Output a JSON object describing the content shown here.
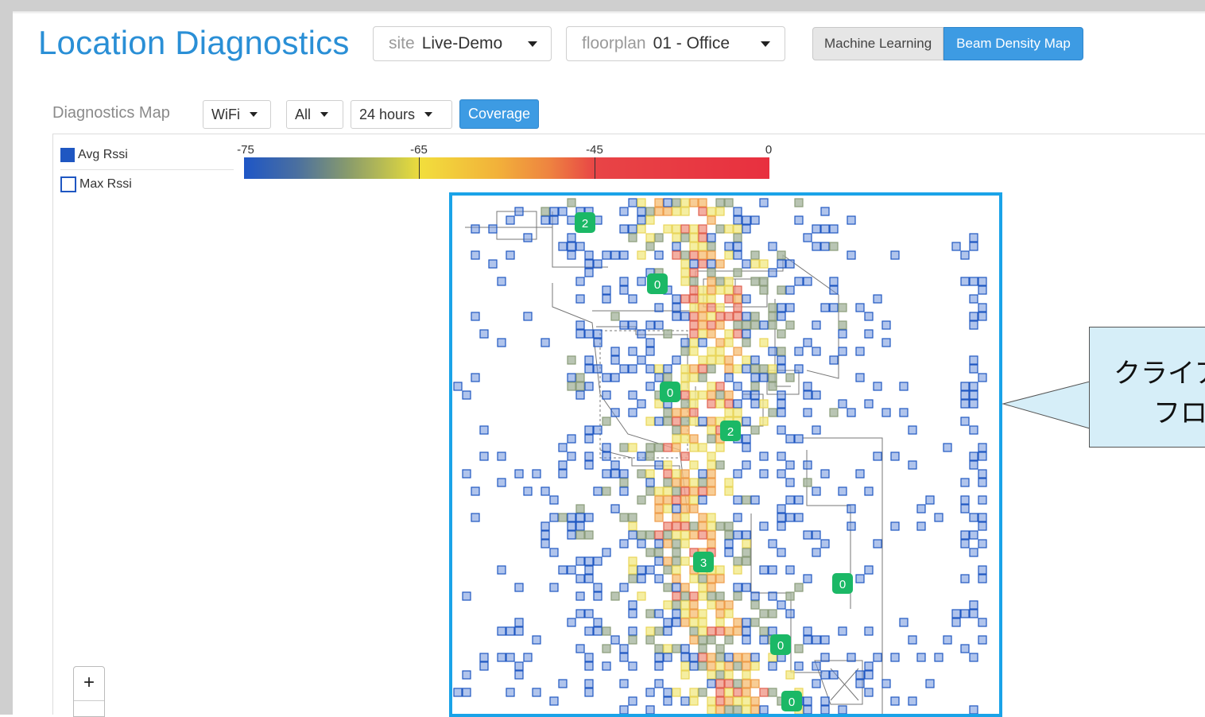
{
  "header": {
    "title": "Location Diagnostics",
    "site_label": "site",
    "site_value": "Live-Demo",
    "floorplan_label": "floorplan",
    "floorplan_value": "01 - Office",
    "tabs": [
      "Machine Learning",
      "Beam Density Map"
    ],
    "active_tab": "Beam Density Map"
  },
  "toolbar": {
    "section_label": "Diagnostics Map",
    "type_select": "WiFi",
    "filter_select": "All",
    "time_select": "24 hours",
    "coverage_button": "Coverage"
  },
  "legend": {
    "avg_label": "Avg Rssi",
    "max_label": "Max Rssi",
    "scale_ticks": [
      "-75",
      "-65",
      "-45",
      "0"
    ],
    "scale_tick_values": [
      -75,
      -65,
      -45,
      0
    ]
  },
  "map": {
    "client_counts": [
      "2",
      "0",
      "0",
      "2",
      "3",
      "0",
      "0",
      "0"
    ],
    "zoom_in": "+"
  },
  "callout": {
    "line1": "クライア",
    "line2": "フロ"
  },
  "colors": {
    "accent": "#3d9be3",
    "highlight_border": "#1aa3e8",
    "badge_green": "#1bb866",
    "avg_blue": "#1f57c2"
  }
}
